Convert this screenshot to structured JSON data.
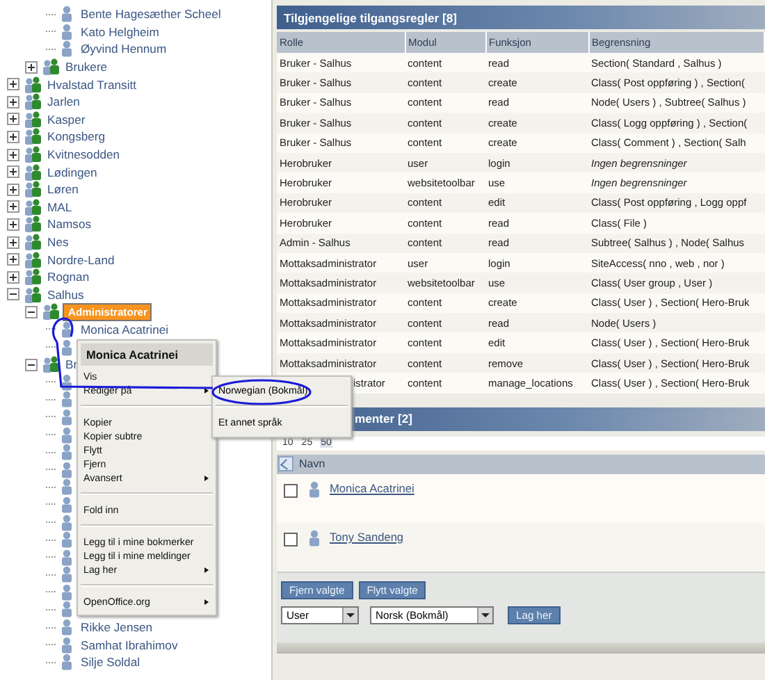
{
  "tree": [
    {
      "kind": "branch",
      "children": [
        {
          "kind": "branch",
          "children": [
            {
              "kind": "user",
              "label": "Bente Hagesæther Scheel",
              "selected": false
            },
            {
              "kind": "user",
              "label": "Kato Helgheim",
              "selected": false
            },
            {
              "kind": "user",
              "label": "Øyvind Hennum",
              "selected": false
            }
          ]
        },
        {
          "kind": "group",
          "label": "Brukere",
          "expanded": false,
          "selected": false
        }
      ]
    },
    {
      "kind": "group",
      "label": "Hvalstad Transitt",
      "expanded": false,
      "selected": false
    },
    {
      "kind": "group",
      "label": "Jarlen",
      "expanded": false,
      "selected": false
    },
    {
      "kind": "group",
      "label": "Kasper",
      "expanded": false,
      "selected": false
    },
    {
      "kind": "group",
      "label": "Kongsberg",
      "expanded": false,
      "selected": false
    },
    {
      "kind": "group",
      "label": "Kvitnesodden",
      "expanded": false,
      "selected": false
    },
    {
      "kind": "group",
      "label": "Lødingen",
      "expanded": false,
      "selected": false
    },
    {
      "kind": "group",
      "label": "Løren",
      "expanded": false,
      "selected": false
    },
    {
      "kind": "group",
      "label": "MAL",
      "expanded": false,
      "selected": false
    },
    {
      "kind": "group",
      "label": "Namsos",
      "expanded": false,
      "selected": false
    },
    {
      "kind": "group",
      "label": "Nes",
      "expanded": false,
      "selected": false
    },
    {
      "kind": "group",
      "label": "Nordre-Land",
      "expanded": false,
      "selected": false
    },
    {
      "kind": "group",
      "label": "Rognan",
      "expanded": false,
      "selected": false
    },
    {
      "kind": "group",
      "label": "Salhus",
      "expanded": true,
      "selected": false,
      "children": [
        {
          "kind": "group",
          "label": "Administratorer",
          "expanded": true,
          "selected": true,
          "children": [
            {
              "kind": "user",
              "label": "Monica Acatrinei",
              "selected": false
            },
            {
              "kind": "user"
            }
          ]
        },
        {
          "kind": "group",
          "label": "Br",
          "expanded": true,
          "selected": false,
          "children": [
            {
              "kind": "user"
            },
            {
              "kind": "user"
            },
            {
              "kind": "user"
            },
            {
              "kind": "user"
            },
            {
              "kind": "user"
            },
            {
              "kind": "user"
            },
            {
              "kind": "user"
            },
            {
              "kind": "user"
            },
            {
              "kind": "user"
            },
            {
              "kind": "user"
            },
            {
              "kind": "user"
            },
            {
              "kind": "user"
            },
            {
              "kind": "user"
            },
            {
              "kind": "user"
            },
            {
              "kind": "user",
              "label": "Rikke Jensen",
              "selected": false
            },
            {
              "kind": "user",
              "label": "Samhat Ibrahimov",
              "selected": false
            },
            {
              "kind": "user",
              "label": "Silje Soldal",
              "selected": false
            }
          ]
        }
      ]
    }
  ],
  "rules_panel": {
    "title": "Tilgjengelige tilgangsregler [8]",
    "columns": [
      "Rolle",
      "Modul",
      "Funksjon",
      "Begrensning"
    ],
    "rows": [
      {
        "cells": [
          "Bruker - Salhus",
          "content",
          "read",
          "Section( Standard , Salhus )"
        ],
        "none": false,
        "covered": false
      },
      {
        "cells": [
          "Bruker - Salhus",
          "content",
          "create",
          "Class( Post oppføring ) , Section("
        ],
        "none": false,
        "covered": false
      },
      {
        "cells": [
          "Bruker - Salhus",
          "content",
          "read",
          "Node( Users ) , Subtree( Salhus )"
        ],
        "none": false,
        "covered": false
      },
      {
        "cells": [
          "Bruker - Salhus",
          "content",
          "create",
          "Class( Logg oppføring ) , Section("
        ],
        "none": false,
        "covered": false
      },
      {
        "cells": [
          "Bruker - Salhus",
          "content",
          "create",
          "Class( Comment ) , Section( Salh"
        ],
        "none": false,
        "covered": false
      },
      {
        "cells": [
          "Herobruker",
          "user",
          "login",
          "Ingen begrensninger"
        ],
        "none": true,
        "covered": false
      },
      {
        "cells": [
          "Herobruker",
          "websitetoolbar",
          "use",
          "Ingen begrensninger"
        ],
        "none": true,
        "covered": false
      },
      {
        "cells": [
          "Herobruker",
          "content",
          "edit",
          "Class( Post oppføring , Logg oppf"
        ],
        "none": false,
        "covered": false
      },
      {
        "cells": [
          "Herobruker",
          "content",
          "read",
          "Class( File )"
        ],
        "none": false,
        "covered": false
      },
      {
        "cells": [
          "Admin - Salhus",
          "content",
          "read",
          "Subtree( Salhus ) , Node( Salhus"
        ],
        "none": false,
        "covered": false
      },
      {
        "cells": [
          "Mottaksadministrator",
          "user",
          "login",
          "SiteAccess( nno , web , nor )"
        ],
        "none": false,
        "covered": false
      },
      {
        "cells": [
          "Mottaksadministrator",
          "websitetoolbar",
          "use",
          "Class( User group , User )"
        ],
        "none": false,
        "covered": false
      },
      {
        "cells": [
          "Mottaksadministrator",
          "content",
          "create",
          "Class( User ) , Section( Hero-Bruk"
        ],
        "none": false,
        "covered": false
      },
      {
        "cells": [
          "Mottaksadministrator",
          "content",
          "read",
          "Node( Users )"
        ],
        "none": false,
        "covered": false
      },
      {
        "cells": [
          "Mottaksadministrator",
          "content",
          "edit",
          "Class( User ) , Section( Hero-Bruk"
        ],
        "none": false,
        "covered": false
      },
      {
        "cells": [
          "Mottaksadministrator",
          "content",
          "remove",
          "Class( User ) , Section( Hero-Bruk"
        ],
        "none": false,
        "covered": false
      },
      {
        "cells": [
          "istrator",
          "content",
          "manage_locations",
          "Class( User ) , Section( Hero-Bruk"
        ],
        "none": false,
        "covered": true
      }
    ]
  },
  "members_panel": {
    "title": "menter [2]",
    "page_sizes": [
      {
        "label": "10",
        "selected": false
      },
      {
        "label": "25",
        "selected": false
      },
      {
        "label": "50",
        "selected": true
      }
    ],
    "column": "Navn",
    "rows": [
      {
        "name": "Monica Acatrinei",
        "checked": false
      },
      {
        "name": "Tony Sandeng",
        "checked": false
      }
    ],
    "buttons": [
      "Fjern valgte",
      "Flytt valgte"
    ],
    "class_select": "User",
    "language_select": "Norsk (Bokmål)",
    "create_button": "Lag her"
  },
  "context_menu": {
    "title": "Monica Acatrinei",
    "items": [
      {
        "kind": "item",
        "label": "Vis",
        "submenu": false
      },
      {
        "kind": "item",
        "label": "Rediger på",
        "submenu": true
      },
      {
        "kind": "separator"
      },
      {
        "kind": "item",
        "label": "Kopier",
        "submenu": false
      },
      {
        "kind": "item",
        "label": "Kopier subtre",
        "submenu": false
      },
      {
        "kind": "item",
        "label": "Flytt",
        "submenu": false
      },
      {
        "kind": "item",
        "label": "Fjern",
        "submenu": false
      },
      {
        "kind": "item",
        "label": "Avansert",
        "submenu": true
      },
      {
        "kind": "separator"
      },
      {
        "kind": "item",
        "label": "Fold inn",
        "submenu": false
      },
      {
        "kind": "separator"
      },
      {
        "kind": "item",
        "label": "Legg til i mine bokmerker",
        "submenu": false
      },
      {
        "kind": "item",
        "label": "Legg til i mine meldinger",
        "submenu": false
      },
      {
        "kind": "item",
        "label": "Lag her",
        "submenu": true
      },
      {
        "kind": "separator"
      },
      {
        "kind": "item",
        "label": "OpenOffice.org",
        "submenu": true
      }
    ]
  },
  "submenu": {
    "items": [
      {
        "kind": "item",
        "label": "Norwegian (Bokmål)"
      },
      {
        "kind": "separator"
      },
      {
        "kind": "item",
        "label": "Et annet språk"
      }
    ]
  }
}
